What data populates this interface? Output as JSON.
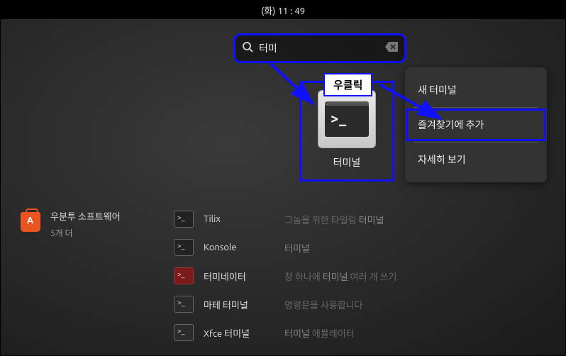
{
  "topbar": {
    "time": "(화) 11 : 49"
  },
  "search": {
    "value": "터미"
  },
  "app": {
    "label": "터미널"
  },
  "callout": {
    "text": "우클릭"
  },
  "menu": {
    "new_terminal": "새 터미널",
    "add_favorite": "즐겨찾기에 추가",
    "details": "자세히 보기"
  },
  "category": {
    "title": "우분투 소프트웨어",
    "more": "5개 더"
  },
  "results": [
    {
      "name": "Tilix",
      "desc_pre": "그놈을 위한 타일링 ",
      "desc_em": "터미널",
      "desc_post": ""
    },
    {
      "name": "Konsole",
      "desc_pre": "",
      "desc_em": "터미널",
      "desc_post": ""
    },
    {
      "name": "터미네이터",
      "desc_pre": "창 하나에 ",
      "desc_em": "터미널",
      "desc_post": " 여러 개 쓰기"
    },
    {
      "name": "마테 터미널",
      "desc_pre": "명령문을 사용합니다",
      "desc_em": "",
      "desc_post": ""
    },
    {
      "name": "Xfce 터미널",
      "desc_pre": "",
      "desc_em": "터미널",
      "desc_post": " 에뮬레이터"
    }
  ]
}
